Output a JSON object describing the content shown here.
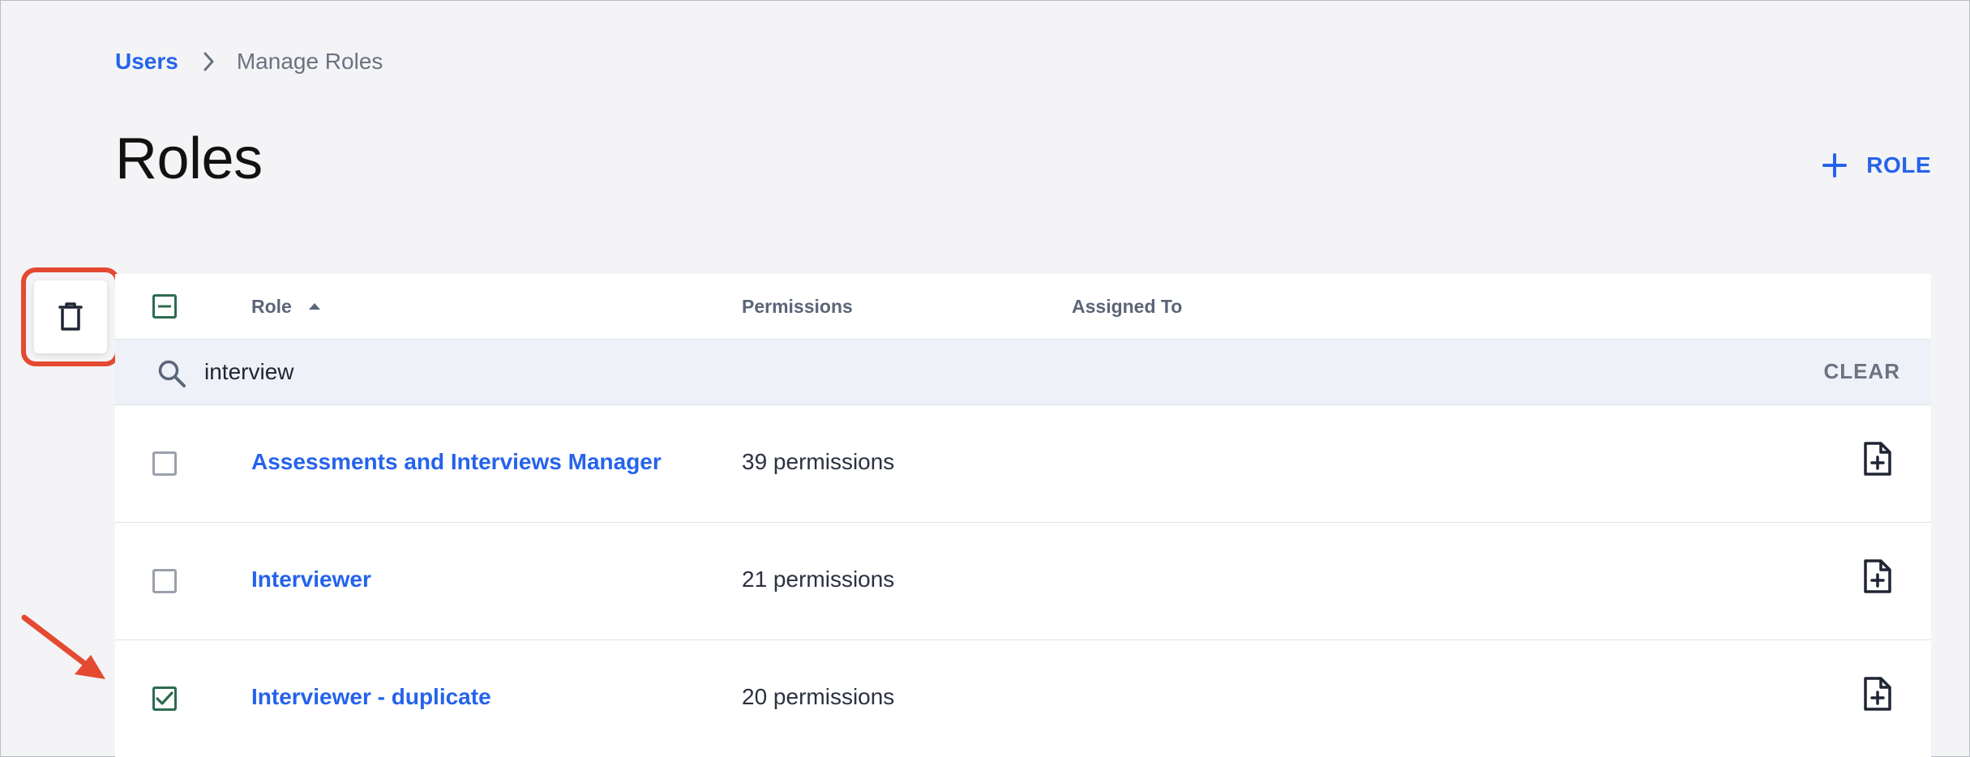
{
  "breadcrumb": {
    "parent": "Users",
    "current": "Manage Roles"
  },
  "page": {
    "title": "Roles"
  },
  "actions": {
    "add_role_label": "ROLE"
  },
  "table": {
    "columns": {
      "role": "Role",
      "permissions": "Permissions",
      "assigned_to": "Assigned To"
    },
    "sort": {
      "column": "role",
      "direction": "ascending"
    },
    "search": {
      "value": "interview",
      "clear_label": "CLEAR"
    },
    "rows": [
      {
        "role": "Assessments and Interviews Manager",
        "permissions": "39 permissions",
        "checked": false
      },
      {
        "role": "Interviewer",
        "permissions": "21 permissions",
        "checked": false
      },
      {
        "role": "Interviewer - duplicate",
        "permissions": "20 permissions",
        "checked": true
      }
    ]
  },
  "colors": {
    "accent": "#2563eb",
    "highlight": "#e44a31",
    "checkbox_checked": "#2e6b4f"
  },
  "icons": [
    "chevron-right-icon",
    "plus-icon",
    "trash-icon",
    "search-icon",
    "sort-asc-icon",
    "duplicate-file-icon",
    "checkmark-icon",
    "minus-icon",
    "arrow-annotation"
  ]
}
